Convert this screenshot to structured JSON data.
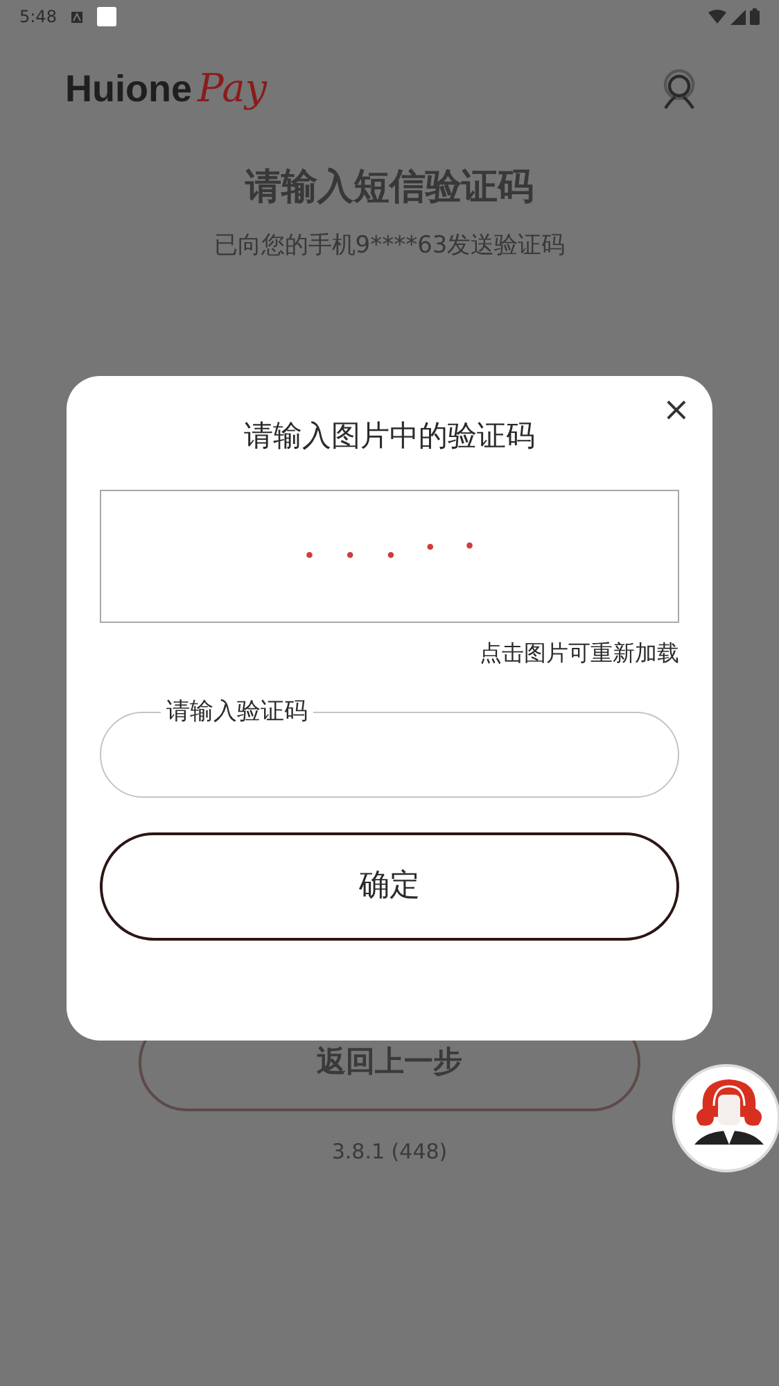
{
  "status_bar": {
    "time": "5:48"
  },
  "logo": {
    "word": "Huione",
    "accent": "Pay"
  },
  "page": {
    "title": "请输入短信验证码",
    "subtitle": "已向您的手机9****63发送验证码",
    "back_button": "返回上一步",
    "version": "3.8.1 (448)"
  },
  "dialog": {
    "title": "请输入图片中的验证码",
    "close": "×",
    "captcha_hint": "点击图片可重新加载",
    "field": {
      "label": "请输入验证码"
    },
    "confirm_button": "确定"
  }
}
